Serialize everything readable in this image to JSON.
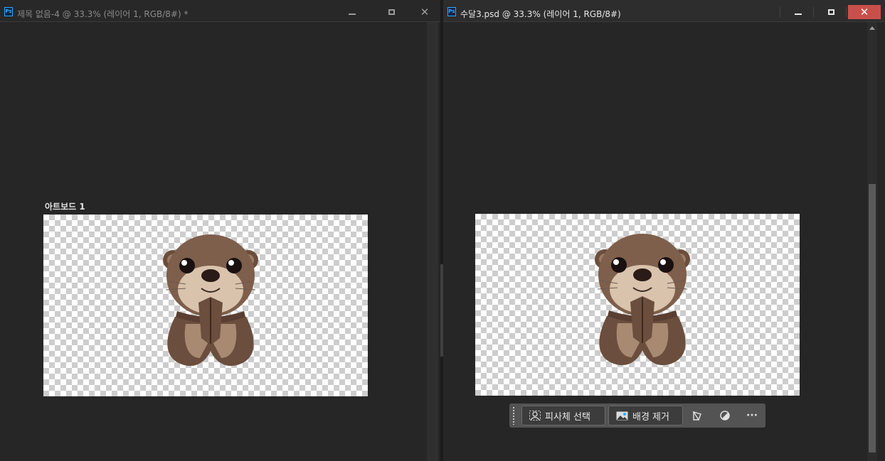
{
  "left_window": {
    "title": "제목 없음-4 @ 33.3% (레이어 1, RGB/8#) *",
    "app_badge": "Ps",
    "artboard_label": "아트보드 1"
  },
  "right_window": {
    "title": "수달3.psd @ 33.3% (레이어 1, RGB/8#)",
    "app_badge": "Ps"
  },
  "window_controls": {
    "minimize_icon": "minimize-icon",
    "maximize_icon": "maximize-icon",
    "close_glyph": "✕"
  },
  "contextual_taskbar": {
    "select_subject_label": "피사체 선택",
    "remove_background_label": "배경 제거",
    "more_label": "···",
    "icons": [
      "person-select-icon",
      "image-remove-bg-icon",
      "transform-icon",
      "adjustment-icon",
      "more-icon"
    ]
  },
  "colors": {
    "close_button_active": "#c9504a",
    "canvas_bg": "#262626",
    "ps_blue": "#31a8ff"
  }
}
